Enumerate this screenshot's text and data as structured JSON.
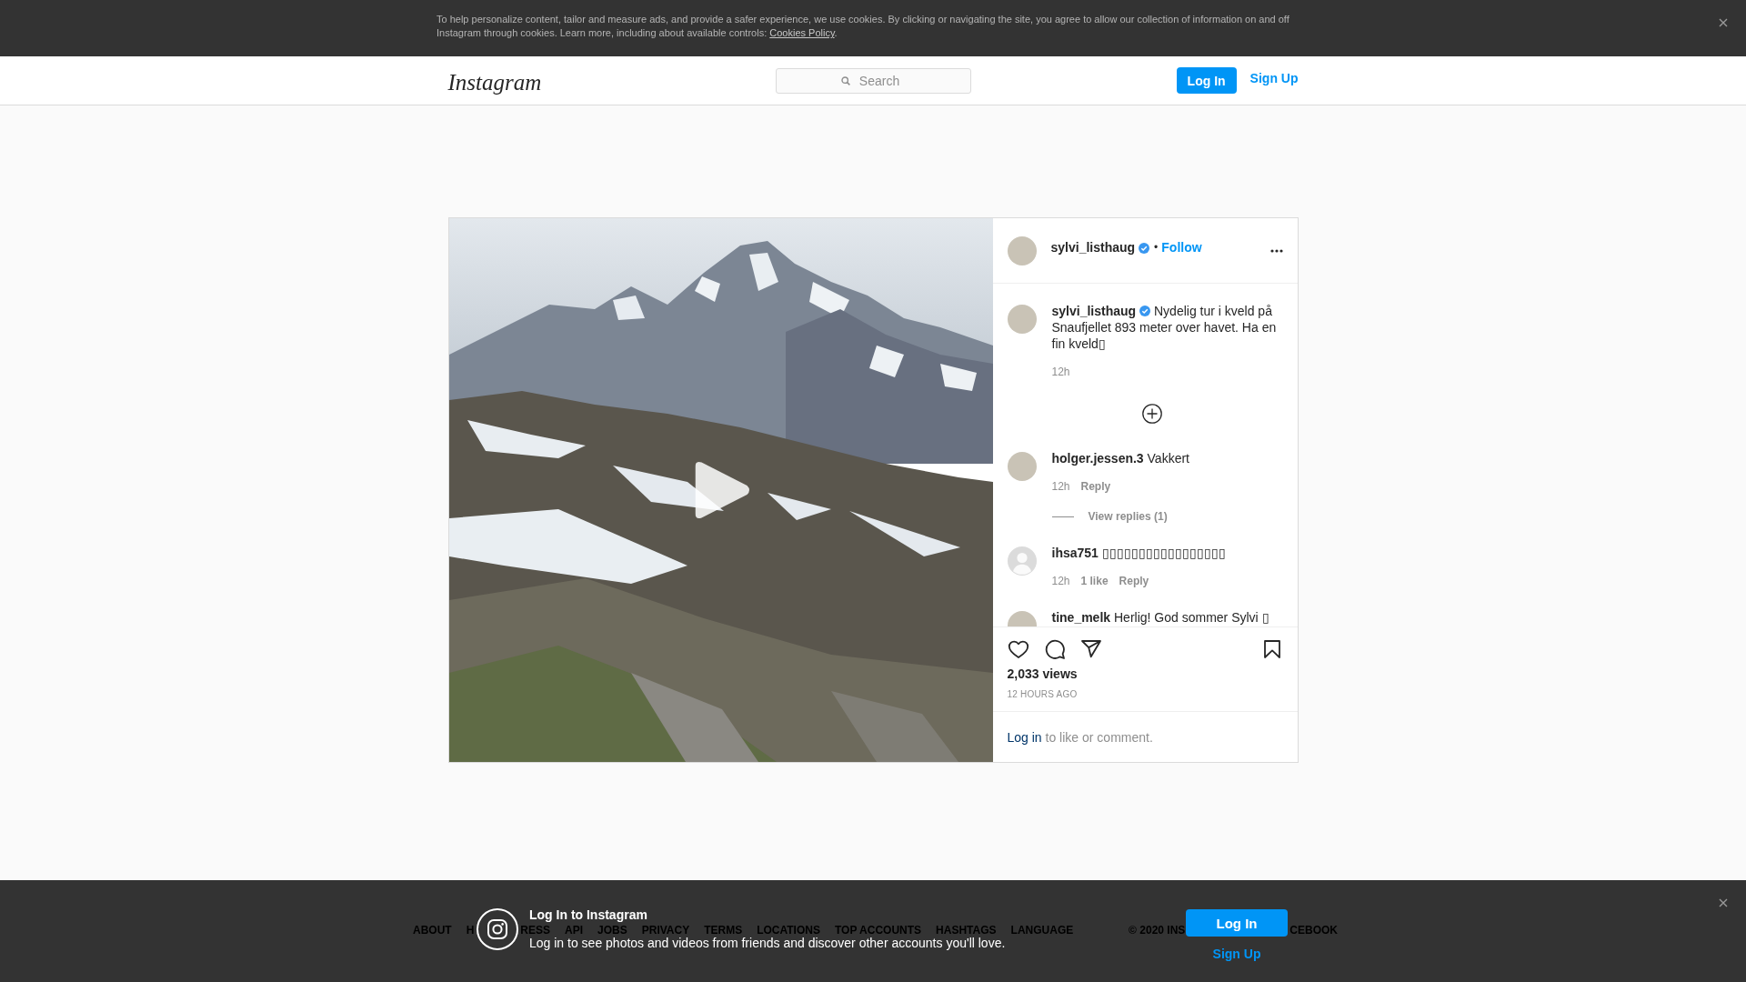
{
  "cookie_banner": {
    "text": "To help personalize content, tailor and measure ads, and provide a safer experience, we use cookies. By clicking or navigating the site, you agree to allow our collection of information on and off Instagram through cookies. Learn more, including about available controls:",
    "link": "Cookies Policy",
    "text_end": "."
  },
  "header": {
    "logo": "Instagram",
    "search": {
      "placeholder": "Search"
    },
    "login_button": "Log In",
    "signup_link": "Sign Up"
  },
  "post": {
    "author": {
      "username": "sylvi_listhaug",
      "verified": true,
      "separator": "•",
      "follow": "Follow"
    },
    "comments": [
      {
        "kind": "caption",
        "avatar_photo": true,
        "username": "sylvi_listhaug",
        "verified": true,
        "text": "Nydelig tur i kveld på Snaufjellet 893 meter over havet. Ha en fin kveld▯",
        "time": "12h"
      },
      {
        "kind": "comment",
        "avatar_photo": true,
        "username": "holger.jessen.3",
        "verified": false,
        "text": "Vakkert",
        "time": "12h",
        "reply": "Reply",
        "view_replies": "View replies (1)"
      },
      {
        "kind": "comment",
        "avatar_photo": false,
        "username": "ihsa751",
        "verified": false,
        "text": "▯▯▯▯▯▯▯▯▯▯▯▯▯▯▯▯▯",
        "time": "12h",
        "likes": "1 like",
        "reply": "Reply"
      },
      {
        "kind": "comment",
        "avatar_photo": true,
        "username": "tine_melk",
        "verified": false,
        "text": "Herlig! God sommer Sylvi ▯"
      }
    ],
    "views": "2,033 views",
    "posted": "12 HOURS AGO",
    "login_prompt": {
      "link": "Log in",
      "text": "to like or comment."
    }
  },
  "footer": {
    "links": [
      "ABOUT",
      "H",
      "RESS",
      "API",
      "JOBS",
      "PRIVACY",
      "TERMS",
      "LOCATIONS",
      "TOP ACCOUNTS",
      "HASHTAGS",
      "LANGUAGE"
    ],
    "copyright": [
      "© 2020 INS",
      "CEBOOK"
    ]
  },
  "login_banner": {
    "title": "Log In to Instagram",
    "text": "Log in to see photos and videos from friends and discover other accounts you'll love.",
    "login_button": "Log In",
    "signup_link": "Sign Up"
  }
}
